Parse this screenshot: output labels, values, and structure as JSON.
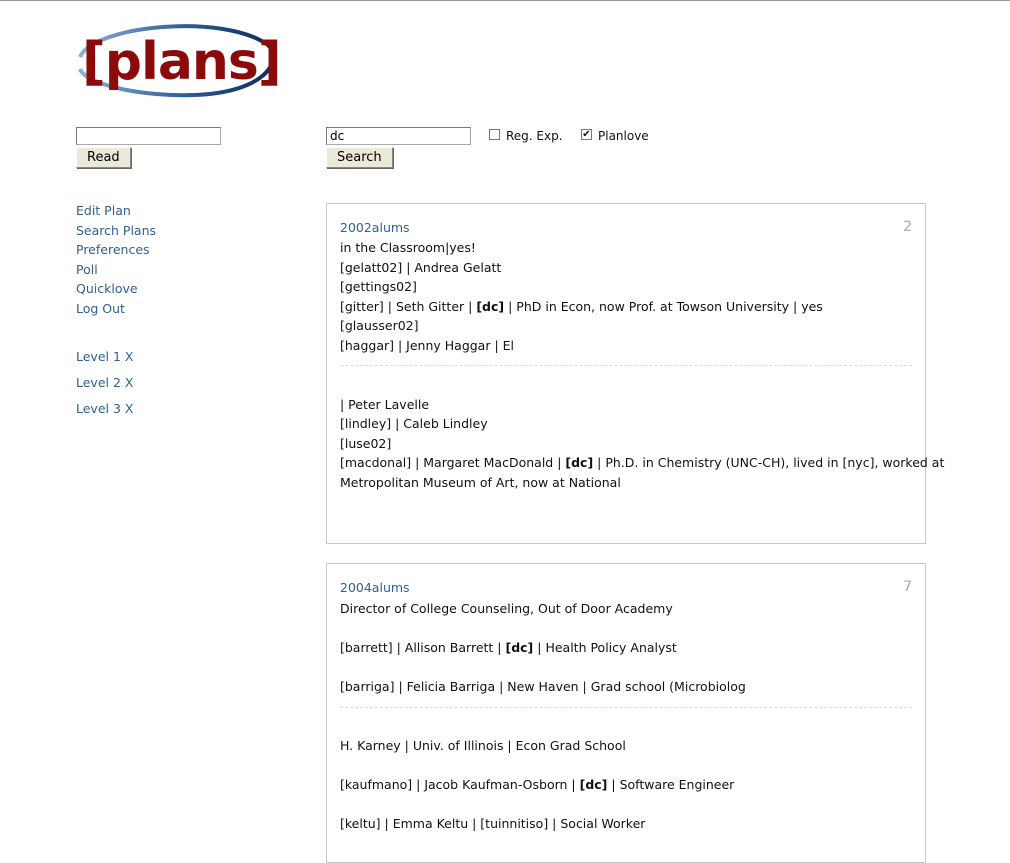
{
  "logo": {
    "text": "[plans]",
    "bracket_color": "#8b0b0b",
    "text_color": "#8b0b0b"
  },
  "read_form": {
    "input_value": "",
    "button_label": "Read"
  },
  "search_form": {
    "input_value": "dc",
    "button_label": "Search",
    "regexp_label": "Reg. Exp.",
    "regexp_checked": false,
    "planlove_label": "Planlove",
    "planlove_checked": true
  },
  "nav": {
    "edit_plan": "Edit Plan",
    "search_plans": "Search Plans",
    "preferences": "Preferences",
    "poll": "Poll",
    "quicklove": "Quicklove",
    "log_out": "Log Out"
  },
  "levels": {
    "l1": "Level 1 X",
    "l2": "Level 2 X",
    "l3": "Level 3 X"
  },
  "results": [
    {
      "username": "2002alums",
      "count": "2",
      "lines": {
        "a1": "in the Classroom|yes!",
        "a2": "[gelatt02] | Andrea Gelatt",
        "a3": "[gettings02]",
        "a4_pre": "[gitter] | Seth Gitter | ",
        "a4_hit": "[dc]",
        "a4_post": " | PhD in Econ, now Prof. at Towson University | yes",
        "a5": "[glausser02]",
        "a6": "[haggar] | Jenny Haggar | El",
        "b1": "| Peter Lavelle",
        "b2": "[lindley] | Caleb Lindley",
        "b3": "[luse02]",
        "b4_pre": "[macdonal] | Margaret MacDonald | ",
        "b4_hit": "[dc]",
        "b4_post": " | Ph.D. in Chemistry (UNC-CH), lived in [nyc], worked at",
        "b5": "Metropolitan Museum of Art, now at National"
      }
    },
    {
      "username": "2004alums",
      "count": "7",
      "lines": {
        "a1": "Director of College Counseling, Out of Door Academy",
        "a2_pre": "[barrett] | Allison Barrett | ",
        "a2_hit": "[dc]",
        "a2_post": " | Health Policy Analyst",
        "a3": "[barriga] | Felicia Barriga | New Haven | Grad school (Microbiolog",
        "b1": "H. Karney | Univ. of Illinois | Econ Grad School",
        "b2_pre": "[kaufmano] | Jacob Kaufman-Osborn | ",
        "b2_hit": "[dc]",
        "b2_post": " | Software Engineer",
        "b3": "[keltu] | Emma Keltu | [tuinnitiso] | Social Worker"
      }
    }
  ]
}
